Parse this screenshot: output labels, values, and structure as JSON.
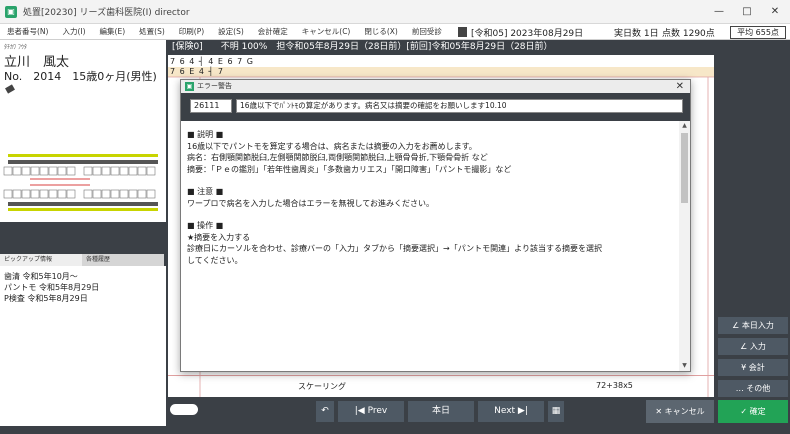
{
  "window": {
    "title": "処置[20230] リーズ歯科医院(I) director",
    "min": "—",
    "max": "□",
    "close": "✕"
  },
  "menu": [
    "患者番号(N)",
    "入力(I)",
    "編集(E)",
    "処置(S)",
    "印刷(P)",
    "設定(S)",
    "会計確定",
    "キャンセル(C)",
    "閉じる(X)",
    "前回受診"
  ],
  "header": {
    "visit_date": "[令和05] 2023年08月29日",
    "visit_days": "実日数 1日",
    "points": "点数 1290点",
    "average": "平均 655点"
  },
  "patient": {
    "kana": "ﾀﾁｶﾜ ﾌｳﾀ",
    "name": "立川　風太",
    "info": "No.　2014　15歳0ヶ月(男性)"
  },
  "insurance": "[保険0]　　不明 100%　担令和05年8月29日（28日前）[前回]令和05年8月29日（28日前）",
  "tooth_rows": [
    "7 6 4 ┤ 4 E 6 7  G",
    "7 6 E 4 ┤ 7"
  ],
  "tabs": {
    "pickup": "ピックアップ情報",
    "history": "各種履歴"
  },
  "pickup": [
    "歯清 令和5年10月～",
    "パントモ 令和5年8月29日",
    "P検査 令和5年8月29日"
  ],
  "record": {
    "label": "スケーリング",
    "value": "72+38x5"
  },
  "dialog": {
    "title": "エラー警告",
    "close": "✕",
    "code": "26111",
    "message": "16歳以下でﾊﾟﾝﾄﾓの算定があります。病名又は摘要の確認をお願いします10.10",
    "body": [
      "■ 説明 ■",
      "16歳以下でパントモを算定する場合は、病名または摘要の入力をお薦めします。",
      "病名：右側顎関節脱臼,左側顎関節脱臼,両側顎関節脱臼,上顎骨骨折,下顎骨骨折 など",
      "摘要：「Ｐｅの鑑別」「若年性歯周炎」「多数歯カリエス」「開口障害」「パントモ撮影」など",
      "",
      "■ 注意 ■",
      "ワープロで病名を入力した場合はエラーを無視してお進みください。",
      "",
      "■ 操作 ■",
      "★摘要を入力する",
      "診療日にカーソルを合わせ、診療バーの「入力」タブから「摘要選択」→「パントモ関連」より該当する摘要を選択",
      "してください。"
    ]
  },
  "side_buttons": [
    "∠ 本日入力",
    "∠ 入力",
    "¥ 会計",
    "… その他"
  ],
  "bottom": {
    "undo": "↶",
    "prev": "|◀ Prev",
    "today": "本日",
    "next": "Next ▶|",
    "calc": "▦",
    "cancel": "✕ キャンセル",
    "ok": "✓ 確定"
  }
}
